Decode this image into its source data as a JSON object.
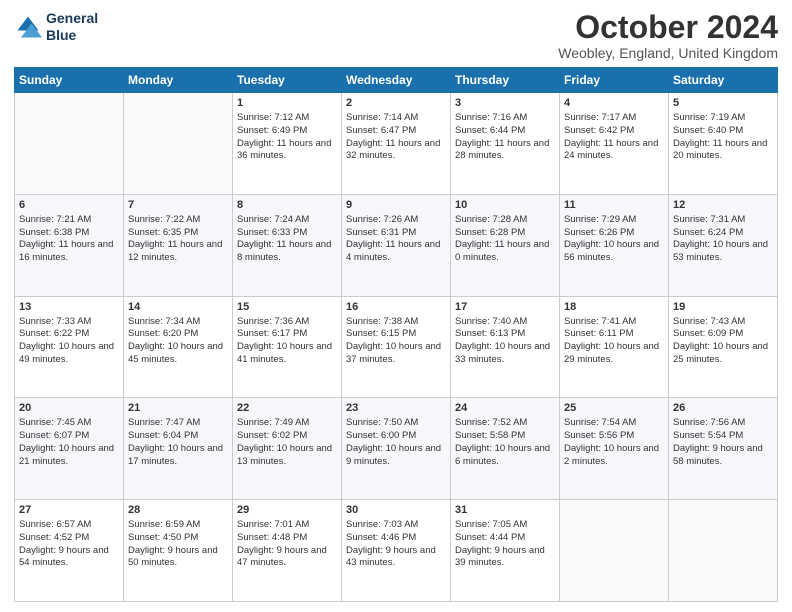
{
  "header": {
    "logo_line1": "General",
    "logo_line2": "Blue",
    "month_title": "October 2024",
    "location": "Weobley, England, United Kingdom"
  },
  "days_of_week": [
    "Sunday",
    "Monday",
    "Tuesday",
    "Wednesday",
    "Thursday",
    "Friday",
    "Saturday"
  ],
  "weeks": [
    [
      {
        "day": "",
        "sunrise": "",
        "sunset": "",
        "daylight": ""
      },
      {
        "day": "",
        "sunrise": "",
        "sunset": "",
        "daylight": ""
      },
      {
        "day": "1",
        "sunrise": "Sunrise: 7:12 AM",
        "sunset": "Sunset: 6:49 PM",
        "daylight": "Daylight: 11 hours and 36 minutes."
      },
      {
        "day": "2",
        "sunrise": "Sunrise: 7:14 AM",
        "sunset": "Sunset: 6:47 PM",
        "daylight": "Daylight: 11 hours and 32 minutes."
      },
      {
        "day": "3",
        "sunrise": "Sunrise: 7:16 AM",
        "sunset": "Sunset: 6:44 PM",
        "daylight": "Daylight: 11 hours and 28 minutes."
      },
      {
        "day": "4",
        "sunrise": "Sunrise: 7:17 AM",
        "sunset": "Sunset: 6:42 PM",
        "daylight": "Daylight: 11 hours and 24 minutes."
      },
      {
        "day": "5",
        "sunrise": "Sunrise: 7:19 AM",
        "sunset": "Sunset: 6:40 PM",
        "daylight": "Daylight: 11 hours and 20 minutes."
      }
    ],
    [
      {
        "day": "6",
        "sunrise": "Sunrise: 7:21 AM",
        "sunset": "Sunset: 6:38 PM",
        "daylight": "Daylight: 11 hours and 16 minutes."
      },
      {
        "day": "7",
        "sunrise": "Sunrise: 7:22 AM",
        "sunset": "Sunset: 6:35 PM",
        "daylight": "Daylight: 11 hours and 12 minutes."
      },
      {
        "day": "8",
        "sunrise": "Sunrise: 7:24 AM",
        "sunset": "Sunset: 6:33 PM",
        "daylight": "Daylight: 11 hours and 8 minutes."
      },
      {
        "day": "9",
        "sunrise": "Sunrise: 7:26 AM",
        "sunset": "Sunset: 6:31 PM",
        "daylight": "Daylight: 11 hours and 4 minutes."
      },
      {
        "day": "10",
        "sunrise": "Sunrise: 7:28 AM",
        "sunset": "Sunset: 6:28 PM",
        "daylight": "Daylight: 11 hours and 0 minutes."
      },
      {
        "day": "11",
        "sunrise": "Sunrise: 7:29 AM",
        "sunset": "Sunset: 6:26 PM",
        "daylight": "Daylight: 10 hours and 56 minutes."
      },
      {
        "day": "12",
        "sunrise": "Sunrise: 7:31 AM",
        "sunset": "Sunset: 6:24 PM",
        "daylight": "Daylight: 10 hours and 53 minutes."
      }
    ],
    [
      {
        "day": "13",
        "sunrise": "Sunrise: 7:33 AM",
        "sunset": "Sunset: 6:22 PM",
        "daylight": "Daylight: 10 hours and 49 minutes."
      },
      {
        "day": "14",
        "sunrise": "Sunrise: 7:34 AM",
        "sunset": "Sunset: 6:20 PM",
        "daylight": "Daylight: 10 hours and 45 minutes."
      },
      {
        "day": "15",
        "sunrise": "Sunrise: 7:36 AM",
        "sunset": "Sunset: 6:17 PM",
        "daylight": "Daylight: 10 hours and 41 minutes."
      },
      {
        "day": "16",
        "sunrise": "Sunrise: 7:38 AM",
        "sunset": "Sunset: 6:15 PM",
        "daylight": "Daylight: 10 hours and 37 minutes."
      },
      {
        "day": "17",
        "sunrise": "Sunrise: 7:40 AM",
        "sunset": "Sunset: 6:13 PM",
        "daylight": "Daylight: 10 hours and 33 minutes."
      },
      {
        "day": "18",
        "sunrise": "Sunrise: 7:41 AM",
        "sunset": "Sunset: 6:11 PM",
        "daylight": "Daylight: 10 hours and 29 minutes."
      },
      {
        "day": "19",
        "sunrise": "Sunrise: 7:43 AM",
        "sunset": "Sunset: 6:09 PM",
        "daylight": "Daylight: 10 hours and 25 minutes."
      }
    ],
    [
      {
        "day": "20",
        "sunrise": "Sunrise: 7:45 AM",
        "sunset": "Sunset: 6:07 PM",
        "daylight": "Daylight: 10 hours and 21 minutes."
      },
      {
        "day": "21",
        "sunrise": "Sunrise: 7:47 AM",
        "sunset": "Sunset: 6:04 PM",
        "daylight": "Daylight: 10 hours and 17 minutes."
      },
      {
        "day": "22",
        "sunrise": "Sunrise: 7:49 AM",
        "sunset": "Sunset: 6:02 PM",
        "daylight": "Daylight: 10 hours and 13 minutes."
      },
      {
        "day": "23",
        "sunrise": "Sunrise: 7:50 AM",
        "sunset": "Sunset: 6:00 PM",
        "daylight": "Daylight: 10 hours and 9 minutes."
      },
      {
        "day": "24",
        "sunrise": "Sunrise: 7:52 AM",
        "sunset": "Sunset: 5:58 PM",
        "daylight": "Daylight: 10 hours and 6 minutes."
      },
      {
        "day": "25",
        "sunrise": "Sunrise: 7:54 AM",
        "sunset": "Sunset: 5:56 PM",
        "daylight": "Daylight: 10 hours and 2 minutes."
      },
      {
        "day": "26",
        "sunrise": "Sunrise: 7:56 AM",
        "sunset": "Sunset: 5:54 PM",
        "daylight": "Daylight: 9 hours and 58 minutes."
      }
    ],
    [
      {
        "day": "27",
        "sunrise": "Sunrise: 6:57 AM",
        "sunset": "Sunset: 4:52 PM",
        "daylight": "Daylight: 9 hours and 54 minutes."
      },
      {
        "day": "28",
        "sunrise": "Sunrise: 6:59 AM",
        "sunset": "Sunset: 4:50 PM",
        "daylight": "Daylight: 9 hours and 50 minutes."
      },
      {
        "day": "29",
        "sunrise": "Sunrise: 7:01 AM",
        "sunset": "Sunset: 4:48 PM",
        "daylight": "Daylight: 9 hours and 47 minutes."
      },
      {
        "day": "30",
        "sunrise": "Sunrise: 7:03 AM",
        "sunset": "Sunset: 4:46 PM",
        "daylight": "Daylight: 9 hours and 43 minutes."
      },
      {
        "day": "31",
        "sunrise": "Sunrise: 7:05 AM",
        "sunset": "Sunset: 4:44 PM",
        "daylight": "Daylight: 9 hours and 39 minutes."
      },
      {
        "day": "",
        "sunrise": "",
        "sunset": "",
        "daylight": ""
      },
      {
        "day": "",
        "sunrise": "",
        "sunset": "",
        "daylight": ""
      }
    ]
  ]
}
